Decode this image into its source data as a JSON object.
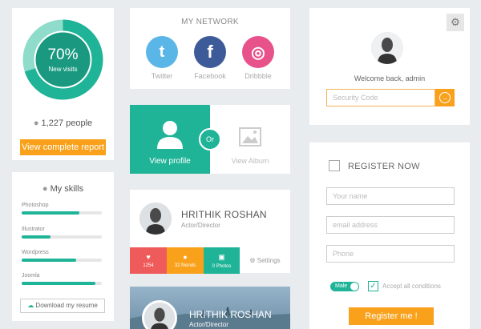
{
  "stats": {
    "percent": "70%",
    "sub": "New visits",
    "progress": 0.7,
    "people": "1,227 people",
    "button": "View complete report"
  },
  "skills": {
    "title": "My skills",
    "items": [
      {
        "name": "Photoshop",
        "level": 0.72
      },
      {
        "name": "Illustrator",
        "level": 0.36
      },
      {
        "name": "Wordpress",
        "level": 0.68
      },
      {
        "name": "Joomla",
        "level": 0.92
      }
    ],
    "download": "Download my resume"
  },
  "network": {
    "title": "MY NETWORK",
    "items": [
      {
        "label": "Twitter",
        "color": "#5bb6e8",
        "glyph": "t"
      },
      {
        "label": "Facebook",
        "color": "#3d5a99",
        "glyph": "f"
      },
      {
        "label": "Dribbble",
        "color": "#e8528a",
        "glyph": "◎"
      }
    ]
  },
  "views": {
    "profile": "View profile",
    "or": "Or",
    "album": "View Album"
  },
  "profile": {
    "name": "HRITHIK ROSHAN",
    "role": "Actor/Director",
    "stats": [
      {
        "value": "1254",
        "color": "#ef5b5b",
        "icon": "♥"
      },
      {
        "value": "32 friends",
        "color": "#f9a11b",
        "icon": "●"
      },
      {
        "value": "0 Photos",
        "color": "#1fb497",
        "icon": "▣"
      }
    ],
    "settings": "Settings"
  },
  "banner": {
    "name": "HRITHIK ROSHAN",
    "role": "Actor/Director"
  },
  "welcome": {
    "text": "Welcome back, admin",
    "placeholder": "Security Code"
  },
  "register": {
    "title": "REGISTER NOW",
    "fields": [
      "Your name",
      "email address",
      "Phone"
    ],
    "toggle": "Male",
    "accept": "Accept all conditions",
    "button": "Register me !"
  }
}
